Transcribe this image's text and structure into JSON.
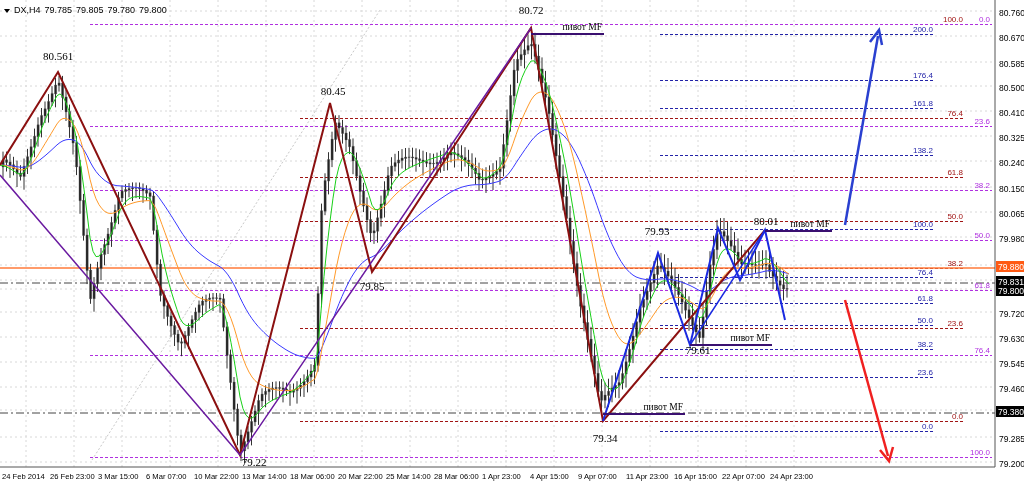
{
  "header": {
    "symbol": "DX,H4",
    "quotes": [
      "79.785",
      "79.805",
      "79.780",
      "79.800"
    ]
  },
  "price_axis": [
    {
      "label": "80.760",
      "kind": "tick"
    },
    {
      "label": "80.670",
      "kind": "tick"
    },
    {
      "label": "80.585",
      "kind": "tick"
    },
    {
      "label": "80.500",
      "kind": "tick"
    },
    {
      "label": "80.410",
      "kind": "tick"
    },
    {
      "label": "80.325",
      "kind": "tick"
    },
    {
      "label": "80.240",
      "kind": "tick"
    },
    {
      "label": "80.150",
      "kind": "tick"
    },
    {
      "label": "80.065",
      "kind": "tick"
    },
    {
      "label": "79.980",
      "kind": "tick"
    },
    {
      "label": "79.880",
      "kind": "marker",
      "color": "#ff5a14"
    },
    {
      "label": "79.831",
      "kind": "marker",
      "color": "#000000"
    },
    {
      "label": "79.800",
      "kind": "marker",
      "color": "#000000"
    },
    {
      "label": "79.720",
      "kind": "tick"
    },
    {
      "label": "79.630",
      "kind": "tick"
    },
    {
      "label": "79.545",
      "kind": "tick"
    },
    {
      "label": "79.460",
      "kind": "tick"
    },
    {
      "label": "79.380",
      "kind": "marker",
      "color": "#000000"
    },
    {
      "label": "79.285",
      "kind": "tick"
    },
    {
      "label": "79.200",
      "kind": "tick"
    }
  ],
  "time_axis": [
    "24 Feb 2014",
    "26 Feb 23:00",
    "3 Mar 15:00",
    "6 Mar 07:00",
    "10 Mar 22:00",
    "13 Mar 14:00",
    "18 Mar 06:00",
    "20 Mar 22:00",
    "25 Mar 14:00",
    "28 Mar 06:00",
    "1 Apr 23:00",
    "4 Apr 15:00",
    "9 Apr 07:00",
    "11 Apr 23:00",
    "16 Apr 15:00",
    "22 Apr 07:00",
    "24 Apr 23:00"
  ],
  "swing_labels": [
    "80.561",
    "80.45",
    "80.72",
    "79.85",
    "79.22",
    "79.93",
    "80.01",
    "79.61",
    "79.34"
  ],
  "pivot_labels": [
    "пивот MF",
    "пивот MF",
    "пивот MF",
    "пивот MF"
  ],
  "fib_sets": [
    {
      "color": "#2323a8",
      "levels": [
        "200.0",
        "176.4",
        "161.8",
        "138.2",
        "100.0",
        "76.4",
        "61.8",
        "50.0",
        "38.2",
        "23.6",
        "0.0"
      ]
    },
    {
      "color": "#a01414",
      "levels": [
        "100.0",
        "76.4",
        "61.8",
        "50.0",
        "38.2",
        "23.6",
        "0.0"
      ]
    },
    {
      "color": "#b030e0",
      "levels": [
        "0.0",
        "23.6",
        "38.2",
        "50.0",
        "61.8",
        "76.4",
        "100.0"
      ]
    }
  ]
}
